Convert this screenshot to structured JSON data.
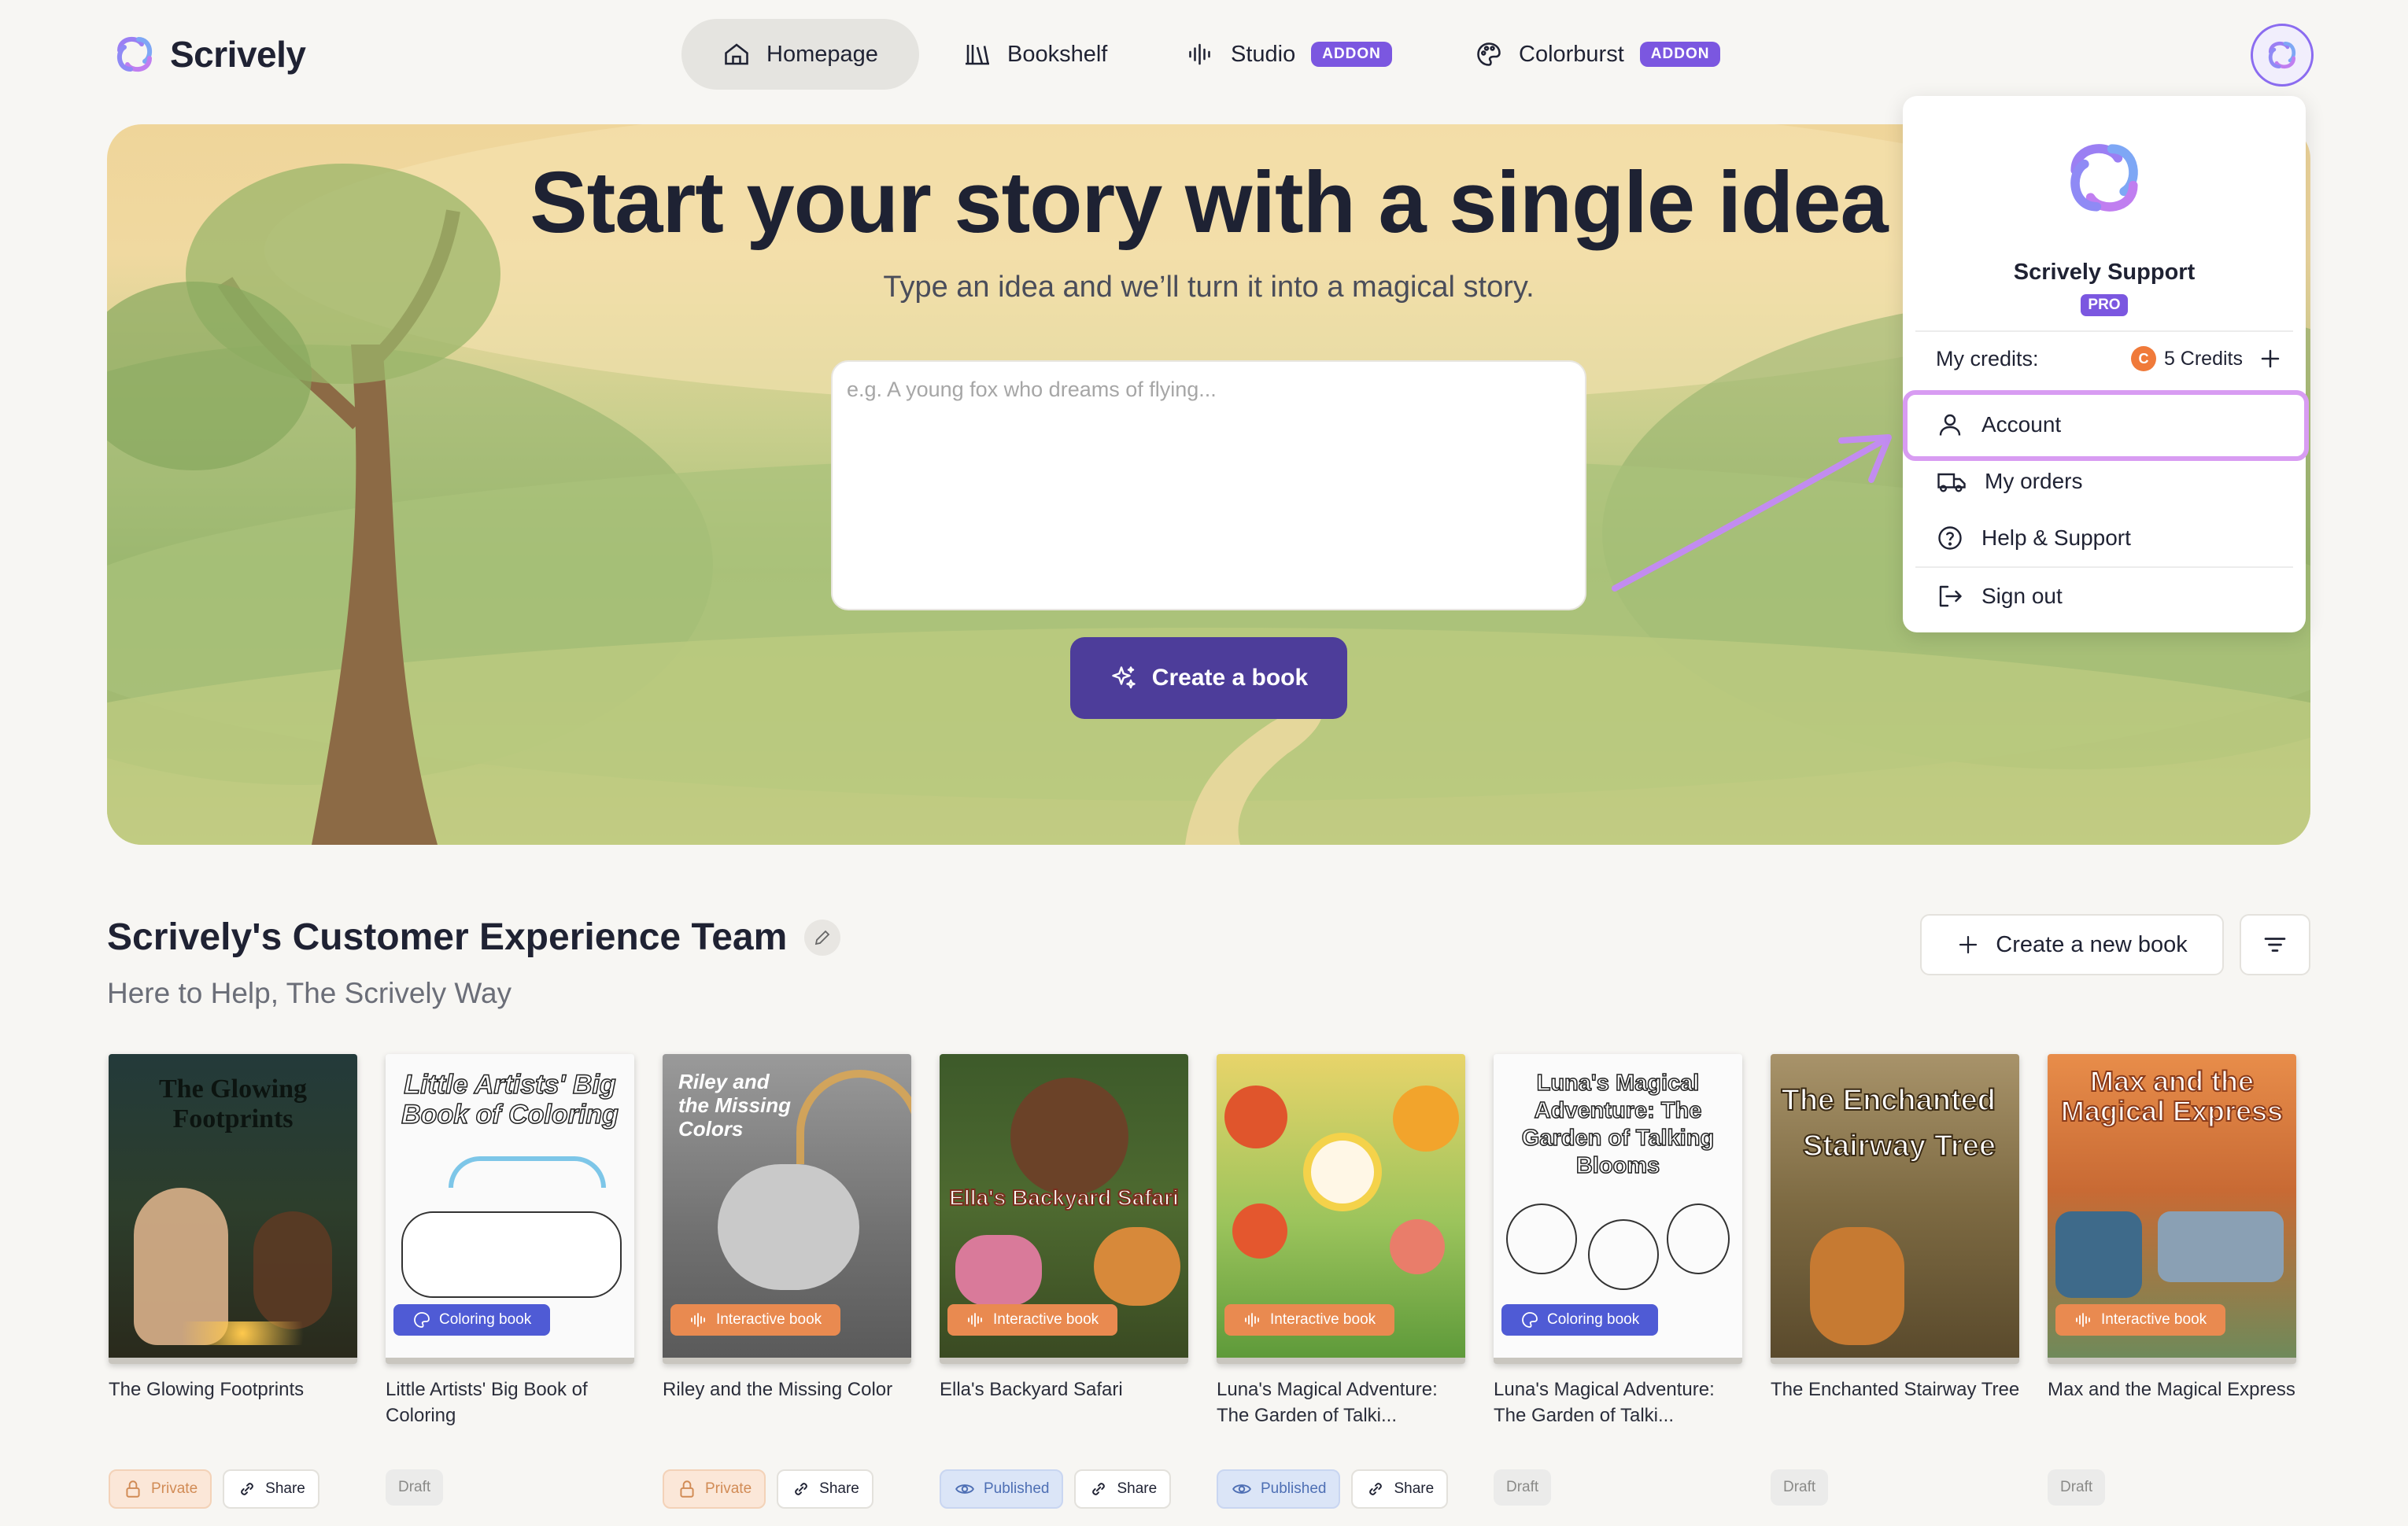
{
  "app": {
    "name": "Scrively"
  },
  "nav": {
    "items": [
      {
        "label": "Homepage"
      },
      {
        "label": "Bookshelf"
      },
      {
        "label": "Studio",
        "badge": "ADDON"
      },
      {
        "label": "Colorburst",
        "badge": "ADDON"
      }
    ]
  },
  "hero": {
    "title": "Start your story with a single idea",
    "subtitle": "Type an idea and we’ll turn it into a magical story.",
    "placeholder": "e.g. A young fox who dreams of flying...",
    "button_label": "Create a book"
  },
  "account_menu": {
    "user_name": "Scrively Support",
    "plan_badge": "PRO",
    "credits_label": "My credits:",
    "credits_coin": "C",
    "credits_value": "5 Credits",
    "items": [
      {
        "label": "Account",
        "icon": "user-icon"
      },
      {
        "label": "My orders",
        "icon": "truck-icon"
      },
      {
        "label": "Help & Support",
        "icon": "help-circle-icon"
      },
      {
        "label": "Sign out",
        "icon": "sign-out-icon"
      }
    ]
  },
  "section": {
    "title": "Scrively's Customer Experience Team",
    "subtitle": "Here to Help, The Scrively Way",
    "new_book_label": "Create a new book"
  },
  "books": [
    {
      "title": "The Glowing Footprints",
      "cover_text": "The Glowing Footprints",
      "tag": "",
      "badges": [
        "Private",
        "Share"
      ]
    },
    {
      "title": "Little Artists' Big Book of Coloring",
      "cover_text": "Little Artists' Big Book of Coloring",
      "tag": "Coloring book",
      "badges": [
        "Draft"
      ]
    },
    {
      "title": "Riley and the Missing Color",
      "cover_text": "Riley and the Missing Colors",
      "tag": "Interactive book",
      "badges": [
        "Private",
        "Share"
      ]
    },
    {
      "title": "Ella's Backyard Safari",
      "cover_text": "Ella's Backyard Safari",
      "tag": "Interactive book",
      "badges": [
        "Published",
        "Share"
      ]
    },
    {
      "title": "Luna's Magical Adventure: The Garden of Talki...",
      "cover_text": "",
      "tag": "Interactive book",
      "badges": [
        "Published",
        "Share"
      ]
    },
    {
      "title": "Luna's Magical Adventure: The Garden of Talki...",
      "cover_text": "Luna's Magical Adventure: The Garden of Talking Blooms",
      "tag": "Coloring book",
      "badges": [
        "Draft"
      ]
    },
    {
      "title": "The Enchanted Stairway Tree",
      "cover_text": "The Enchanted Stairway Tree",
      "tag": "",
      "badges": [
        "Draft"
      ]
    },
    {
      "title": "Max and the Magical Express",
      "cover_text": "Max and the Magical Express",
      "tag": "Interactive book",
      "badges": [
        "Draft"
      ]
    }
  ]
}
